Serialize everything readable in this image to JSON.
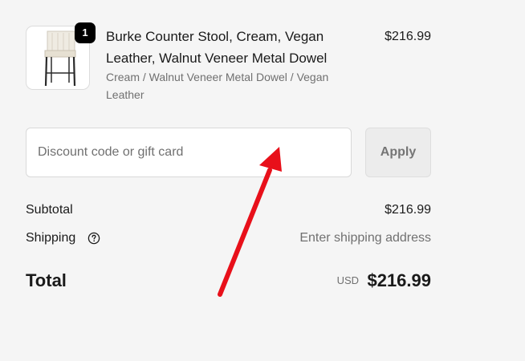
{
  "cart_item": {
    "quantity": "1",
    "title": "Burke Counter Stool, Cream, Vegan Leather, Walnut Veneer Metal Dowel",
    "variant": "Cream / Walnut Veneer Metal Dowel / Vegan Leather",
    "price": "$216.99",
    "image_icon": "bar-stool-product-image"
  },
  "discount": {
    "placeholder": "Discount code or gift card",
    "value": "",
    "apply_label": "Apply"
  },
  "summary": {
    "subtotal_label": "Subtotal",
    "subtotal_value": "$216.99",
    "shipping_label": "Shipping",
    "shipping_value": "Enter shipping address",
    "shipping_help_icon": "question-circle-icon",
    "total_label": "Total",
    "total_currency": "USD",
    "total_value": "$216.99"
  },
  "colors": {
    "page_background": "#f5f5f5",
    "annotation_arrow": "#e8101a",
    "badge_background": "#000000"
  }
}
